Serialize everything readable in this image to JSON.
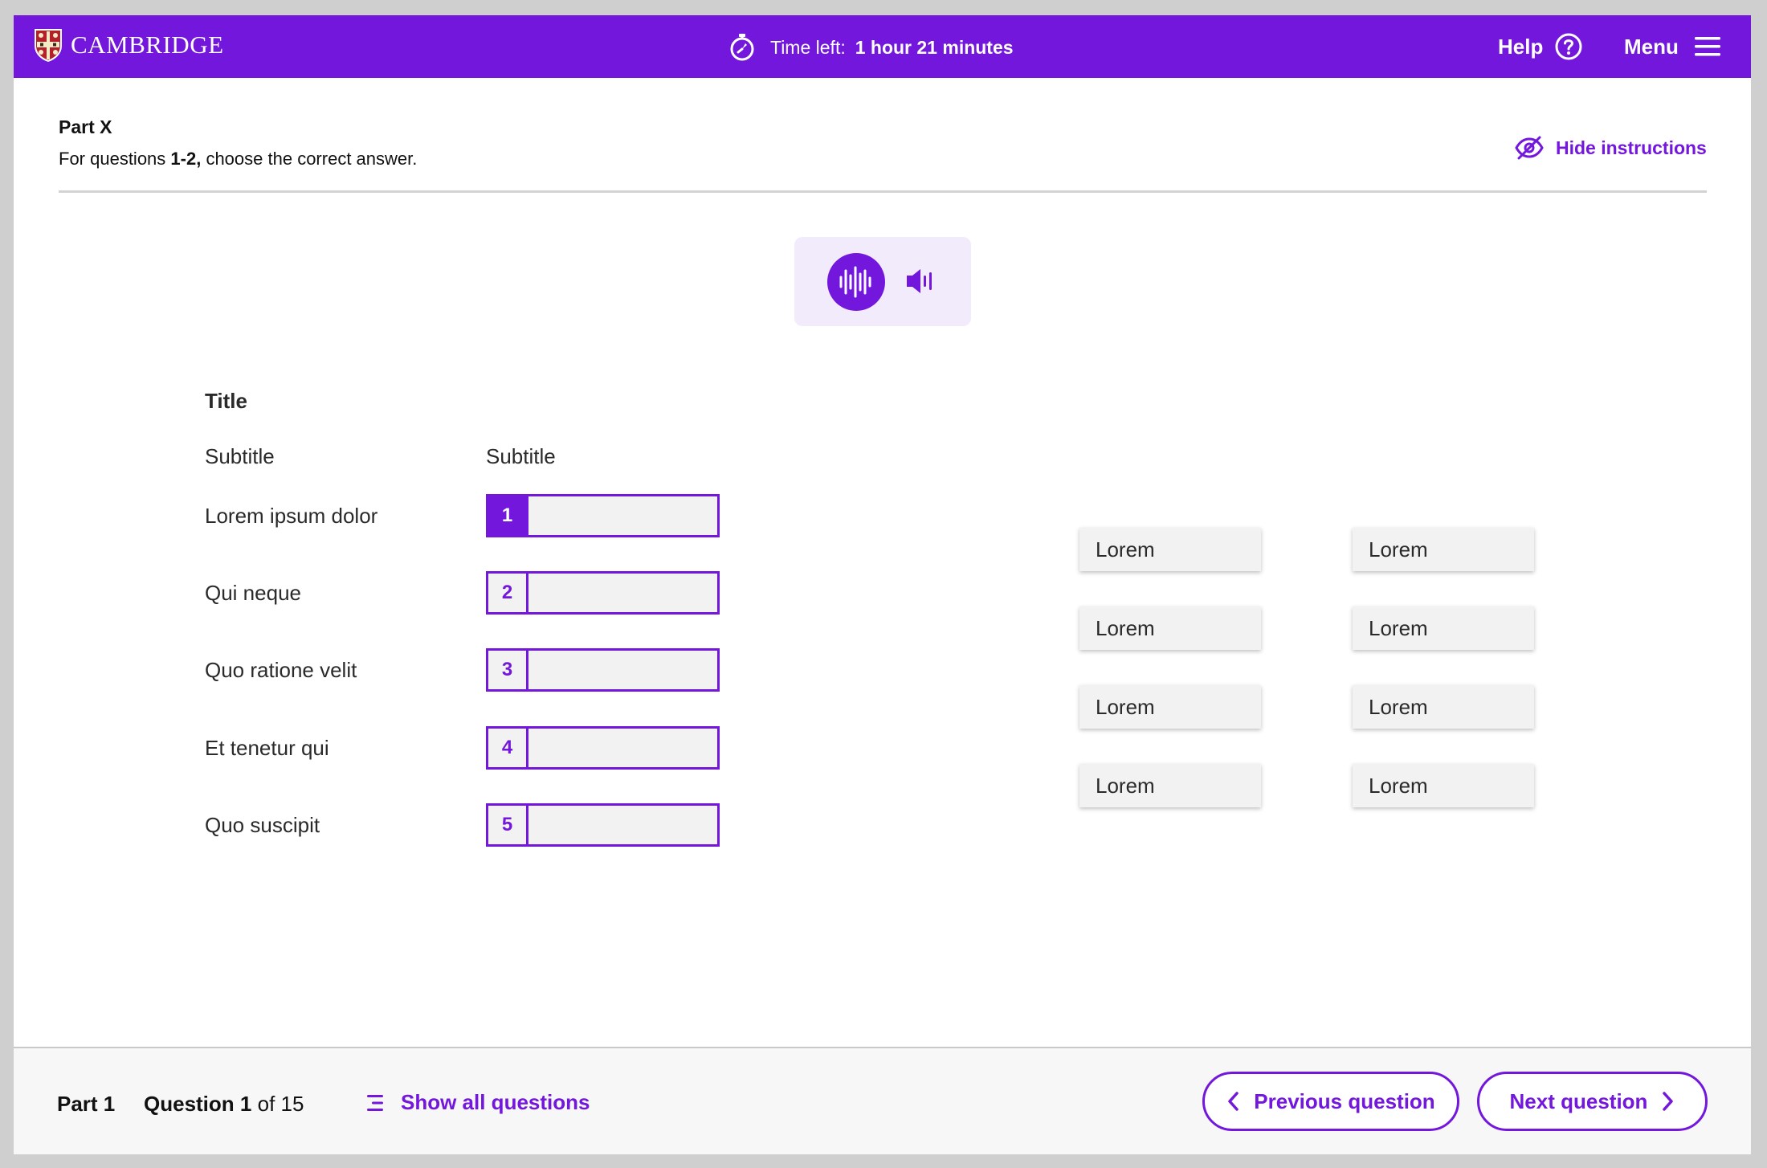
{
  "header": {
    "logo_text": "CAMBRIDGE",
    "timer_label": "Time left:",
    "timer_value": "1 hour 21 minutes",
    "help_label": "Help",
    "menu_label": "Menu"
  },
  "instructions": {
    "part_title": "Part X",
    "text_before": "For questions ",
    "text_bold": "1-2,",
    "text_after": " choose the correct answer.",
    "hide_label": "Hide instructions"
  },
  "task": {
    "title": "Title",
    "subtitle_left": "Subtitle",
    "subtitle_right": "Subtitle",
    "rows": [
      {
        "label": "Lorem ipsum dolor",
        "number": "1"
      },
      {
        "label": "Qui neque",
        "number": "2"
      },
      {
        "label": "Quo ratione velit",
        "number": "3"
      },
      {
        "label": "Et tenetur qui",
        "number": "4"
      },
      {
        "label": "Quo suscipit",
        "number": "5"
      }
    ],
    "options": [
      "Lorem",
      "Lorem",
      "Lorem",
      "Lorem",
      "Lorem",
      "Lorem",
      "Lorem",
      "Lorem"
    ]
  },
  "footer": {
    "part_label": "Part 1",
    "question_word": "Question",
    "question_num": "1",
    "question_of": "of 15",
    "show_all_label": "Show all questions",
    "prev_label": "Previous question",
    "next_label": "Next question"
  },
  "colors": {
    "brand": "#7217db",
    "audio_bg": "#f1ebfc",
    "gap_bg": "#f2f2f2"
  }
}
